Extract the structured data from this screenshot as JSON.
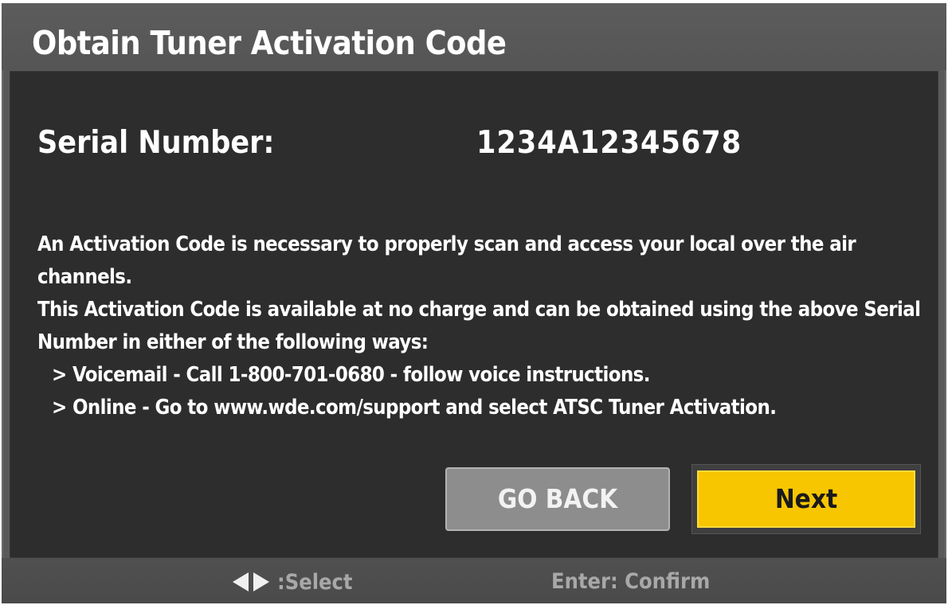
{
  "dialog": {
    "title": "Obtain Tuner Activation Code",
    "serial_label": "Serial Number:",
    "serial_value": "1234A12345678",
    "paragraph_1": "An Activation Code is necessary to properly scan and access your local over the air channels.",
    "paragraph_2": "This Activation Code is available at no charge and can be obtained using the above Serial Number in either of the following ways:",
    "bullets": [
      "> Voicemail - Call 1-800-701-0680 - follow voice instructions.",
      "> Online - Go to www.wde.com/support and select ATSC Tuner Activation."
    ]
  },
  "buttons": {
    "go_back": "GO BACK",
    "next": "Next"
  },
  "footer": {
    "select_icons": [
      "arrow-left-icon",
      "arrow-right-icon"
    ],
    "select_hint": ":Select",
    "confirm_hint": "Enter: Confirm"
  },
  "colors": {
    "background_panel": "#2d2d2d",
    "frame": "#5a5a5a",
    "next_button": "#f7c600",
    "back_button": "#8d8d8d",
    "hint_text": "#a8a8a8"
  }
}
